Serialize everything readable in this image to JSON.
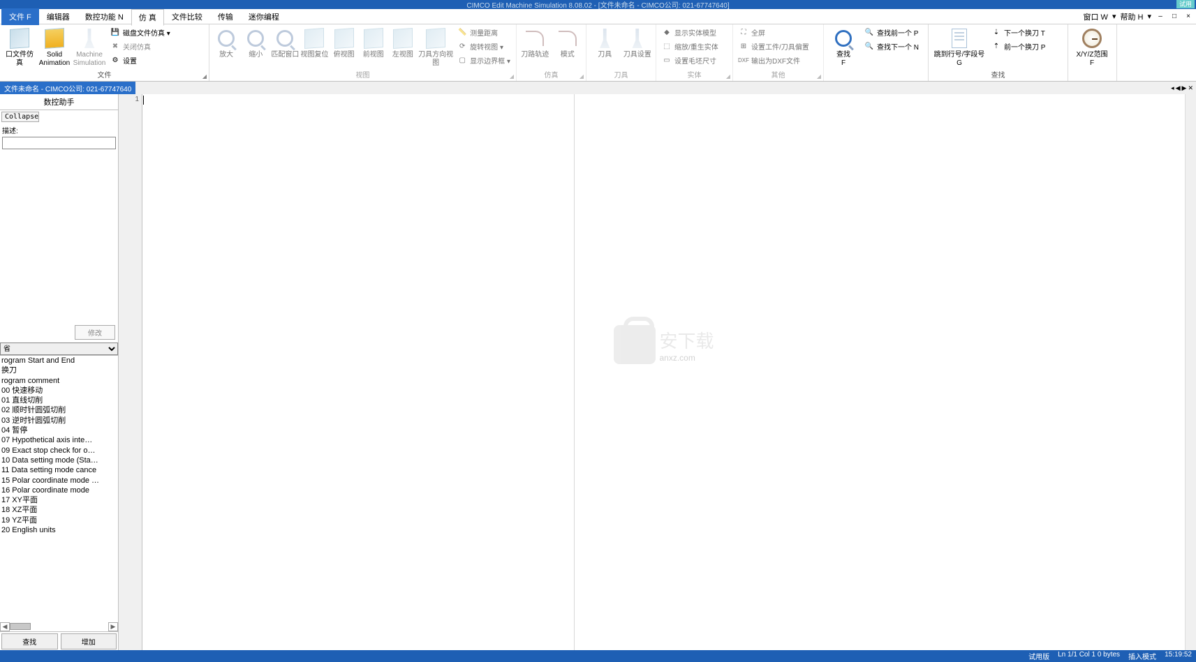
{
  "title_center": "CIMCO Edit Machine Simulation 8.08.02 - [文件未命名 - CIMCO公司: 021-67747640]",
  "title_badge": "试用",
  "menu": {
    "tabs": [
      "文件 F",
      "编辑器",
      "数控功能 N",
      "仿  真",
      "文件比较",
      "传输",
      "迷你编程"
    ],
    "active_index": 3,
    "right": {
      "window": "窗口 W",
      "help": "帮助 H",
      "dash": "–",
      "max": "□",
      "close": "×"
    }
  },
  "ribbon": {
    "groups": [
      {
        "label": "file_group",
        "big": [
          {
            "name": "import-sim",
            "text": "口文件仿真"
          },
          {
            "name": "solid-anim",
            "text": "Solid\nAnimation"
          },
          {
            "name": "machine-sim",
            "text": "Machine\nSimulation"
          }
        ],
        "small": [
          {
            "icon": "disk",
            "text": "磁盘文件仿真 ▾"
          },
          {
            "icon": "close",
            "text": "关闭仿真"
          },
          {
            "icon": "gear",
            "text": "设置"
          }
        ],
        "footer": "文件"
      },
      {
        "label": "view_group",
        "big": [
          {
            "name": "zoom-in",
            "text": "放大"
          },
          {
            "name": "zoom-out",
            "text": "缩小"
          },
          {
            "name": "fit-window",
            "text": "匹配窗口"
          },
          {
            "name": "view-reset",
            "text": "视图复位"
          },
          {
            "name": "top-view",
            "text": "俯视图"
          },
          {
            "name": "front-view",
            "text": "前视图"
          },
          {
            "name": "left-view",
            "text": "左视图"
          },
          {
            "name": "tool-dir",
            "text": "刀具方向视图"
          }
        ],
        "small": [
          {
            "icon": "ruler",
            "text": "测量距离"
          },
          {
            "icon": "rotate",
            "text": "旋转视图 ▾"
          },
          {
            "icon": "bounds",
            "text": "显示边界框 ▾"
          }
        ],
        "footer": "视图"
      },
      {
        "label": "sim_group",
        "big": [
          {
            "name": "toolpath",
            "text": "刀路轨迹"
          },
          {
            "name": "mode",
            "text": "模式"
          }
        ],
        "footer": "仿真"
      },
      {
        "label": "tool_group",
        "big": [
          {
            "name": "tool",
            "text": "刀具"
          },
          {
            "name": "tool-setup",
            "text": "刀具设置"
          }
        ],
        "footer": "刀具"
      },
      {
        "label": "solid_group",
        "small": [
          {
            "icon": "solid",
            "text": "显示实体模型"
          },
          {
            "icon": "scale",
            "text": "缩放/重生实体"
          },
          {
            "icon": "stock",
            "text": "设置毛坯尺寸"
          }
        ],
        "footer": "实体"
      },
      {
        "label": "other_group",
        "small": [
          {
            "icon": "full",
            "text": "全屏"
          },
          {
            "icon": "offset",
            "text": "设置工件/刀具偏置"
          },
          {
            "icon": "dxf",
            "text": "输出为DXF文件"
          }
        ],
        "footer": "其他"
      },
      {
        "label": "find_group",
        "big": [
          {
            "name": "find",
            "text": "查找\nF"
          }
        ],
        "small": [
          {
            "icon": "findprev",
            "text": "查找前一个 P"
          },
          {
            "icon": "findnext",
            "text": "查找下一个 N"
          }
        ],
        "footer": ""
      },
      {
        "label": "goto_group",
        "big": [
          {
            "name": "goto-line",
            "text": "跳到行号/字段号\nG"
          }
        ],
        "small": [
          {
            "icon": "nexttool",
            "text": "下一个换刀 T"
          },
          {
            "icon": "prevtool",
            "text": "前一个换刀 P"
          }
        ],
        "footer": "查找"
      },
      {
        "label": "range_group",
        "big": [
          {
            "name": "xyz-range",
            "text": "X/Y/Z范围\nF"
          }
        ],
        "footer": ""
      }
    ]
  },
  "doc_tab": "文件未命名 - CIMCO公司: 021-67747640",
  "doc_tabs_right": [
    "◂",
    "◀",
    "▶",
    "✕"
  ],
  "left": {
    "title": "数控助手",
    "collapse": "Collapse",
    "desc_label": "描述:",
    "modify": "修改",
    "category": "省",
    "list": [
      "rogram Start and End",
      "换刀",
      "rogram comment",
      "00 快速移动",
      "01 直线切削",
      "02 顺时针圆弧切削",
      "03 逆时针圆弧切削",
      "04 暂停",
      "07 Hypothetical axis inte…",
      "09 Exact stop check for o…",
      "10 Data setting mode (Sta…",
      "11 Data setting mode cance",
      "15 Polar coordinate mode …",
      "16 Polar coordinate mode",
      "17 XY平面",
      "18 XZ平面",
      "19 YZ平面",
      "20 English units"
    ],
    "find": "查找",
    "add": "增加"
  },
  "editor": {
    "line1": "1"
  },
  "watermark": {
    "text1": "安下载",
    "text2": "anxz.com"
  },
  "status": {
    "trial": "试用版",
    "pos": "Ln 1/1  Col 1  0 bytes",
    "mode": "插入模式",
    "time": "15:19:52"
  }
}
